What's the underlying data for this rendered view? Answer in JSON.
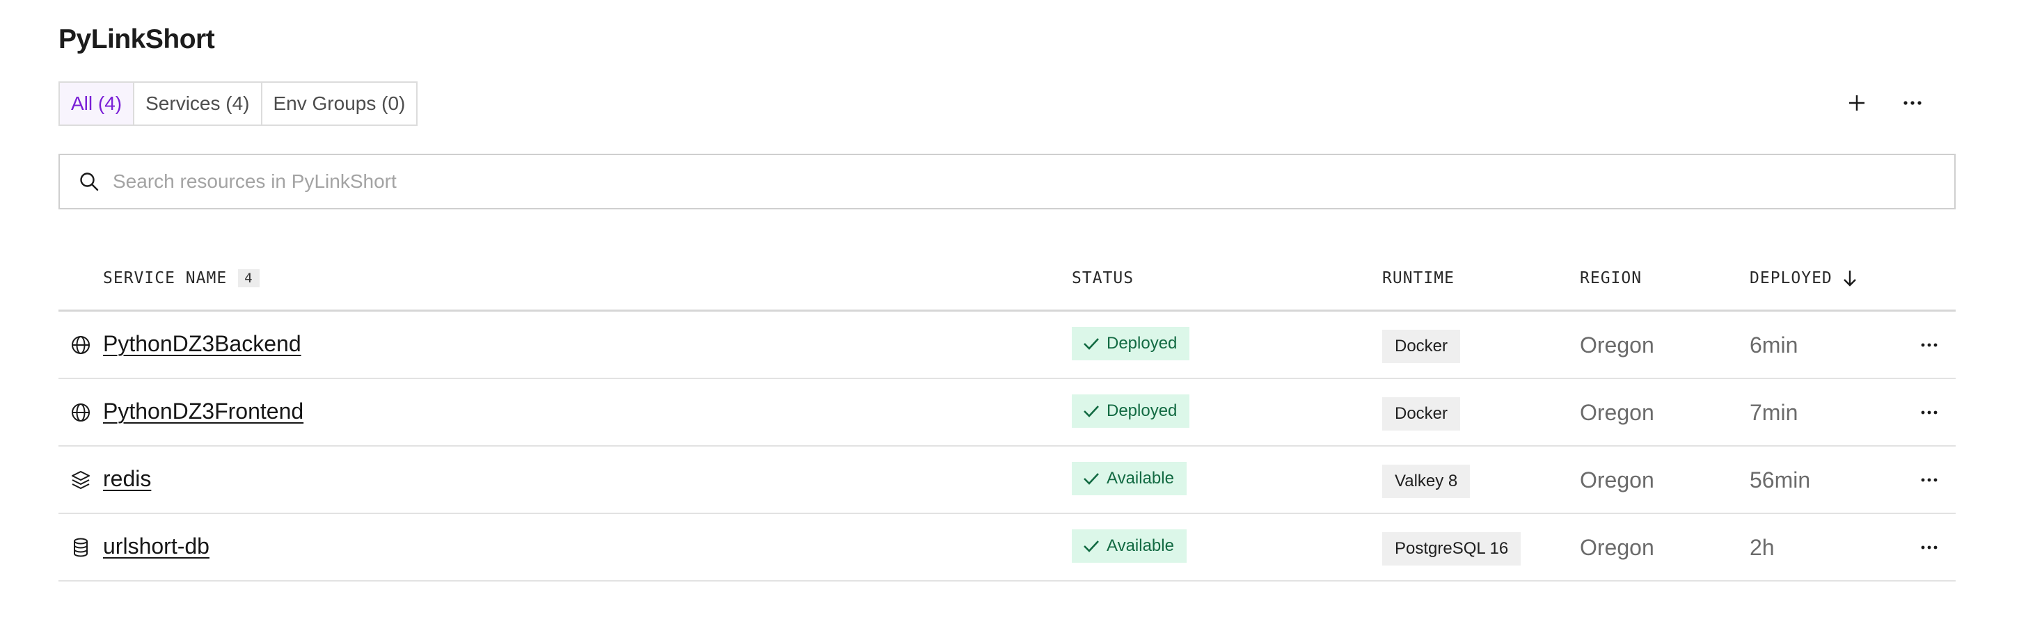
{
  "project": {
    "title": "PyLinkShort"
  },
  "tabs": [
    {
      "label": "All (4)",
      "active": true
    },
    {
      "label": "Services (4)",
      "active": false
    },
    {
      "label": "Env Groups (0)",
      "active": false
    }
  ],
  "header_actions": {
    "add_icon": "plus-icon",
    "more_icon": "ellipsis-icon"
  },
  "search": {
    "placeholder": "Search resources in PyLinkShort",
    "value": ""
  },
  "table": {
    "columns": {
      "service_name": "SERVICE NAME",
      "service_count": "4",
      "status": "STATUS",
      "runtime": "RUNTIME",
      "region": "REGION",
      "deployed": "DEPLOYED"
    },
    "sort": {
      "column": "deployed",
      "direction": "descending",
      "icon": "arrow-down-icon"
    },
    "rows": [
      {
        "icon": "globe-icon",
        "name": "PythonDZ3Backend",
        "status": "Deployed",
        "runtime": "Docker",
        "region": "Oregon",
        "deployed": "6min"
      },
      {
        "icon": "globe-icon",
        "name": "PythonDZ3Frontend",
        "status": "Deployed",
        "runtime": "Docker",
        "region": "Oregon",
        "deployed": "7min"
      },
      {
        "icon": "layers-icon",
        "name": "redis",
        "status": "Available",
        "runtime": "Valkey 8",
        "region": "Oregon",
        "deployed": "56min"
      },
      {
        "icon": "database-icon",
        "name": "urlshort-db",
        "status": "Available",
        "runtime": "PostgreSQL 16",
        "region": "Oregon",
        "deployed": "2h"
      }
    ]
  },
  "colors": {
    "accent": "#7a1fd6",
    "status_bg": "#dcf7e9",
    "status_text": "#126a42",
    "runtime_bg": "#efefef"
  }
}
